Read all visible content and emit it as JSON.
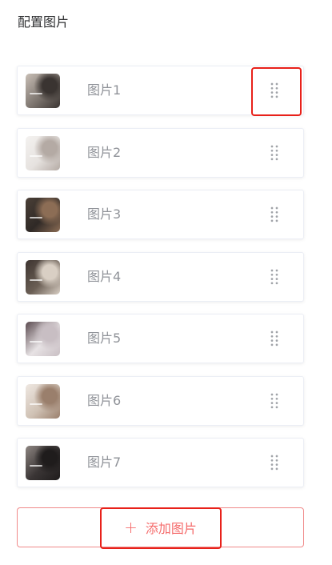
{
  "title": "配置图片",
  "items": [
    {
      "label": "图片1",
      "thumb_colors": [
        "#7d756f",
        "#3a3431",
        "#c9bfb6"
      ]
    },
    {
      "label": "图片2",
      "thumb_colors": [
        "#e6e2df",
        "#b4aaa4",
        "#f4f2f0"
      ]
    },
    {
      "label": "图片3",
      "thumb_colors": [
        "#2f2926",
        "#8c6d55",
        "#4b4037"
      ]
    },
    {
      "label": "图片4",
      "thumb_colors": [
        "#6b5f55",
        "#d9cfc4",
        "#3d3430"
      ]
    },
    {
      "label": "图片5",
      "thumb_colors": [
        "#e7e2e4",
        "#c8bec3",
        "#5a4a4f"
      ]
    },
    {
      "label": "图片6",
      "thumb_colors": [
        "#cfc1b4",
        "#9a7f6c",
        "#efe8e2"
      ]
    },
    {
      "label": "图片7",
      "thumb_colors": [
        "#3a3535",
        "#1f1c1c",
        "#8e8682"
      ]
    }
  ],
  "drag_icon": "drag-dots-icon",
  "add_button": {
    "icon": "plus",
    "label": "添加图片"
  },
  "colors": {
    "accent_red": "#f56c6c",
    "annotation_red": "#e8211a",
    "label_gray": "#909399",
    "handle_gray": "#a0a3a8"
  }
}
